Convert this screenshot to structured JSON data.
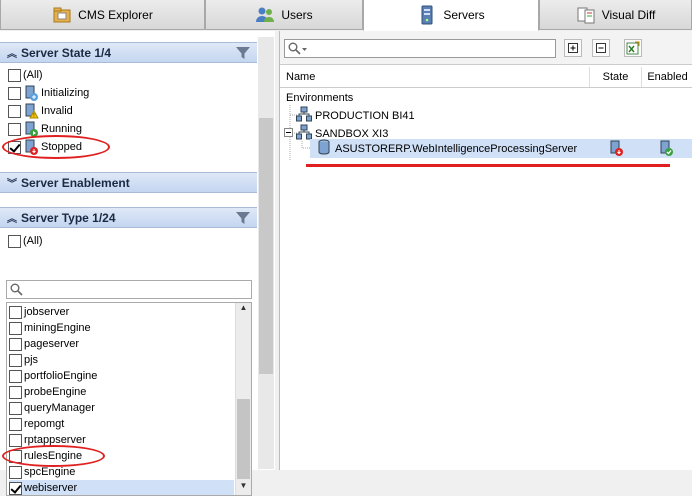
{
  "tabs": [
    {
      "label": "CMS Explorer",
      "icon": "cms-explorer-icon"
    },
    {
      "label": "Users",
      "icon": "users-icon"
    },
    {
      "label": "Servers",
      "icon": "servers-icon"
    },
    {
      "label": "Visual Diff",
      "icon": "visual-diff-icon"
    }
  ],
  "active_tab": "Servers",
  "left_panel": {
    "server_state": {
      "title": "Server State 1/4",
      "items": [
        {
          "label": "(All)",
          "checked": false
        },
        {
          "label": "Initializing",
          "checked": false
        },
        {
          "label": "Invalid",
          "checked": false
        },
        {
          "label": "Running",
          "checked": false
        },
        {
          "label": "Stopped",
          "checked": true
        }
      ]
    },
    "server_enablement": {
      "title": "Server Enablement"
    },
    "server_type": {
      "title": "Server Type 1/24",
      "all_label": "(All)",
      "items": [
        {
          "label": "jobserver",
          "checked": false
        },
        {
          "label": "miningEngine",
          "checked": false
        },
        {
          "label": "pageserver",
          "checked": false
        },
        {
          "label": "pjs",
          "checked": false
        },
        {
          "label": "portfolioEngine",
          "checked": false
        },
        {
          "label": "probeEngine",
          "checked": false
        },
        {
          "label": "queryManager",
          "checked": false
        },
        {
          "label": "repomgt",
          "checked": false
        },
        {
          "label": "rptappserver",
          "checked": false
        },
        {
          "label": "rulesEngine",
          "checked": false
        },
        {
          "label": "spcEngine",
          "checked": false
        },
        {
          "label": "webiserver",
          "checked": true
        }
      ]
    }
  },
  "right_panel": {
    "columns": {
      "name": "Name",
      "state": "State",
      "enabled": "Enabled"
    },
    "tree": {
      "root": "Environments",
      "nodes": [
        {
          "label": "PRODUCTION BI41",
          "expanded": false
        },
        {
          "label": "SANDBOX XI3",
          "expanded": true,
          "children": [
            {
              "label": "ASUSTORERP.WebIntelligenceProcessingServer",
              "state": "stopped",
              "enabled": true
            }
          ]
        }
      ]
    }
  },
  "colors": {
    "accent_header": "#c4d6f0",
    "selection": "#cfe0f7",
    "highlight_red": "#e02020"
  }
}
